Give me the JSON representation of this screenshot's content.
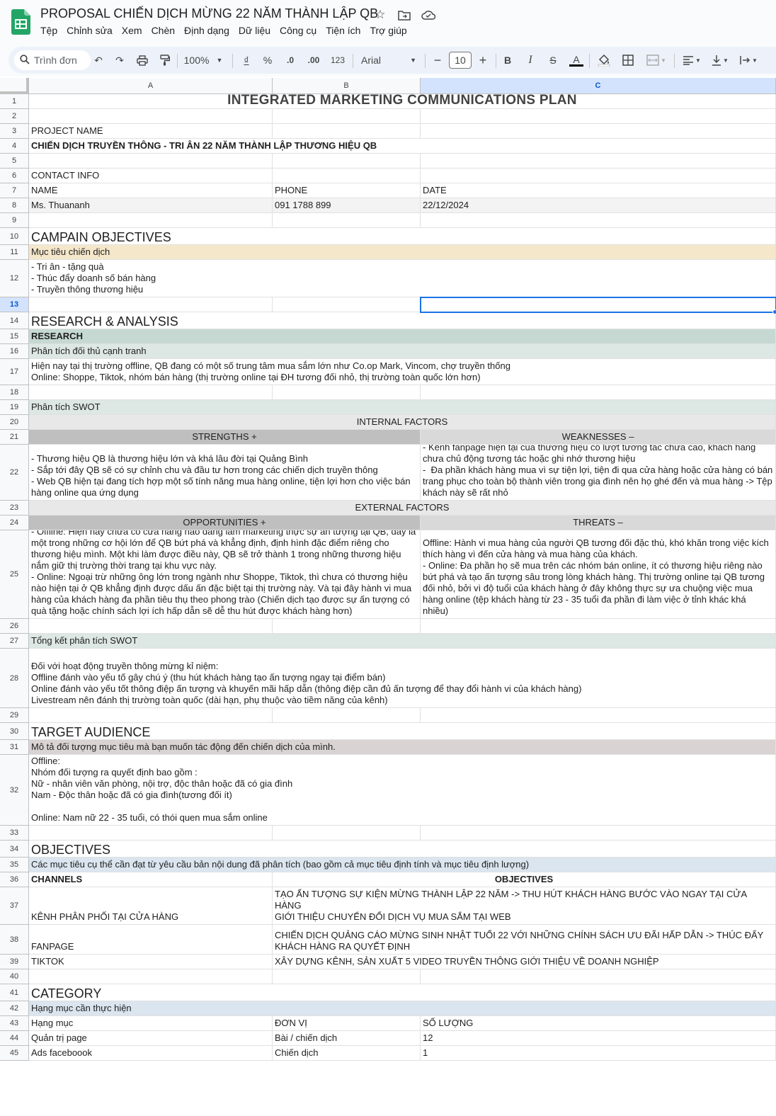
{
  "doc": {
    "title": "PROPOSAL CHIẾN DỊCH MỪNG 22 NĂM THÀNH LẬP QB"
  },
  "menu": [
    "Tệp",
    "Chỉnh sửa",
    "Xem",
    "Chèn",
    "Định dạng",
    "Dữ liệu",
    "Công cụ",
    "Tiện ích",
    "Trợ giúp"
  ],
  "toolbar": {
    "search_placeholder": "Trình đơn",
    "zoom": "100%",
    "currency": "₫",
    "percent": "%",
    "dec_decrease": ".0",
    "dec_increase": ".00",
    "number_format": "123",
    "font": "Arial",
    "font_size": "10",
    "bold": "B",
    "italic": "I",
    "strike": "S",
    "text_color": "A"
  },
  "columns": [
    "A",
    "B",
    "C"
  ],
  "selected": {
    "column": "C",
    "row": "13"
  },
  "rows": [
    "1",
    "2",
    "3",
    "4",
    "5",
    "6",
    "7",
    "8",
    "9",
    "10",
    "11",
    "12",
    "13",
    "14",
    "15",
    "16",
    "17",
    "18",
    "19",
    "20",
    "21",
    "22",
    "23",
    "24",
    "25",
    "26",
    "27",
    "28",
    "29",
    "30",
    "31",
    "32",
    "33",
    "34",
    "35",
    "36",
    "37",
    "38",
    "39",
    "40",
    "41",
    "42",
    "43",
    "44",
    "45"
  ],
  "sheet": {
    "r1": "INTEGRATED MARKETING COMMUNICATIONS PLAN",
    "r3": "PROJECT NAME",
    "r4": "CHIẾN DỊCH TRUYỀN THÔNG - TRI ÂN 22 NĂM THÀNH LẬP THƯƠNG HIỆU QB",
    "r6": "CONTACT INFO",
    "r7": [
      "NAME",
      "PHONE",
      "DATE"
    ],
    "r8": [
      "Ms. Thuananh",
      "091 1788 899",
      "22/12/2024"
    ],
    "r10": "CAMPAIN OBJECTIVES",
    "r11": "Mục tiêu chiến dịch",
    "r12": "- Tri ân - tặng quà\n- Thúc đẩy doanh số bán hàng\n- Truyền thông thương hiệu",
    "r14": "RESEARCH & ANALYSIS",
    "r15": "RESEARCH",
    "r16": "Phân tích đối thủ cạnh tranh",
    "r17": "Hiện nay tại thị trường offline, QB đang có một số trung tâm mua sắm lớn như Co.op Mark, Vincom, chợ truyền thống\nOnline: Shoppe, Tiktok, nhóm bán hàng (thị trường online tại ĐH tương đối nhỏ, thị trường toàn quốc lớn hơn)",
    "r19": "Phân tích SWOT",
    "r20": "INTERNAL FACTORS",
    "r21": [
      "STRENGTHS +",
      "WEAKNESSES –"
    ],
    "r22": [
      "- Thương hiệu QB là thương hiệu lớn và khá lâu đời tại Quảng Bình\n- Sắp tới đây QB sẽ có sự chỉnh chu và đầu tư hơn trong các chiến dịch truyền thông\n- Web QB hiện tại đang tích hợp một số tính năng mua hàng online, tiện lợi hơn cho việc bán hàng online qua ứng dụng",
      "- Kênh fanpage hiện tại của thương hiệu có lượt tương tác chưa cao, khách hàng chưa chủ động tương tác hoặc ghi nhớ thương hiệu\n-  Đa phần khách hàng mua vì sự tiện lợi, tiện đi qua cửa hàng hoặc cửa hàng có bán trang phục cho toàn bộ thành viên trong gia đình nên họ ghé đến và mua hàng -> Tệp khách này sẽ rất nhỏ"
    ],
    "r23": "EXTERNAL FACTORS",
    "r24": [
      "OPPORTUNITIES +",
      "THREATS –"
    ],
    "r25": [
      "- Offline: Hiện nay chưa có cửa hàng nào đang làm marketing thực sự ấn tượng tại QB, đây là một trong những cơ hội lớn để QB bứt phá và khẳng định, định hình đặc điểm riêng cho thương hiệu mình. Một khi làm được điều này, QB sẽ trở thành 1 trong những thương hiệu nắm giữ thị trường thời trang tại khu vực này.\n- Online: Ngoại trừ những ông lớn trong ngành như Shoppe, Tiktok, thì chưa có thương hiệu nào hiện tại ở QB khẳng định được dấu ấn đặc biệt tại thị trường này. Và tại đây hành vi mua hàng của khách hàng đa phần tiêu thụ theo phong trào (Chiến dịch tạo được sự ấn tượng có quà tặng hoặc chính sách lợi ích hấp dẫn sẽ dễ thu hút được khách hàng hơn)",
      "Offline: Hành vi mua hàng của người QB tương đối đặc thù, khó khăn trong việc kích thích hàng vì đến cửa hàng và mua hàng của khách.\n- Online: Đa phần họ sẽ mua trên các nhóm bán online, ít có thương hiệu riêng nào bứt phá và tạo ấn tượng sâu trong lòng khách hàng. Thị trường online tại QB tương đối nhỏ, bởi vì độ tuổi của khách hàng ở đây không thực sự ưa chuộng việc mua hàng online (tệp khách hàng từ 23 - 35 tuổi đa phần đi làm việc ở tỉnh khác khá nhiều)"
    ],
    "r27": "Tổng kết phân tích SWOT",
    "r28": "Đối với hoạt động truyền thông mừng kỉ niệm:\nOffline đánh vào yếu tố gây chú ý (thu hút khách hàng tạo ấn tượng ngay tại điểm bán)\nOnline đánh vào yếu tốt thông điệp ấn tượng và khuyến mãi hấp dẫn (thông điệp cần đủ ấn tượng để thay đổi hành vi của khách hàng)\nLivestream nên đánh thị trường toàn quốc (dài hạn, phụ thuộc vào tiềm năng của kênh)",
    "r30": "TARGET AUDIENCE",
    "r31": "Mô tả đối tượng mục tiêu mà bạn muốn tác động đến chiến dịch của mình.",
    "r32": "Offline:\nNhóm đối tượng ra quyết định bao gồm :\nNữ - nhân viên văn phòng, nội trợ, độc thân hoặc đã có gia đình\nNam - Độc thân hoặc đã có gia đình(tương đối ít)\n\nOnline: Nam nữ 22 - 35 tuổi, có thói quen mua sắm online",
    "r34": "OBJECTIVES",
    "r35": "Các mục tiêu cụ thể cần đạt từ yêu cầu bản nội dung đã phân tích (bao gồm cả mục tiêu định tính và mục tiêu định lượng)",
    "r36": [
      "CHANNELS",
      "OBJECTIVES"
    ],
    "r37": [
      "KÊNH PHÂN PHỐI TẠI CỬA HÀNG",
      "TẠO ẤN TƯỢNG SỰ KIỆN MỪNG THÀNH LẬP 22 NĂM -> THU HÚT KHÁCH HÀNG BƯỚC VÀO NGAY TẠI CỬA HÀNG\nGIỚI THIỆU CHUYỂN ĐỔI DỊCH VỤ MUA SẮM TẠI WEB"
    ],
    "r38": [
      "FANPAGE",
      "CHIẾN DỊCH QUẢNG CÁO MỪNG SINH NHẬT TUỔI 22 VỚI NHỮNG CHÍNH SÁCH ƯU ĐÃI HẤP DẪN -> THÚC ĐẨY KHÁCH HÀNG RA QUYẾT ĐỊNH"
    ],
    "r39": [
      "TIKTOK",
      "XÂY DỰNG KÊNH, SẢN XUẤT 5 VIDEO TRUYỀN THÔNG GIỚI THIỆU VỀ DOANH NGHIỆP"
    ],
    "r41": "CATEGORY",
    "r42": "Hạng mục cần thực hiện",
    "r43": [
      "Hạng mục",
      "ĐƠN VỊ",
      "SỐ LƯỢNG"
    ],
    "r44": [
      "Quản trị page",
      "Bài / chiến dịch",
      "12"
    ],
    "r45": [
      "Ads faceboook",
      "Chiến dịch",
      "1"
    ]
  }
}
